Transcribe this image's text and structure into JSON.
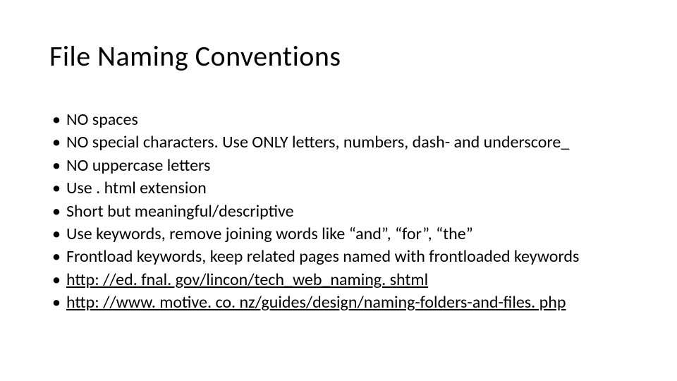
{
  "slide": {
    "title": "File Naming Conventions",
    "bullets": [
      {
        "text": "NO spaces",
        "link": false
      },
      {
        "text": "NO special characters. Use ONLY letters, numbers, dash- and underscore_",
        "link": false
      },
      {
        "text": "NO uppercase letters",
        "link": false
      },
      {
        "text": "Use . html extension",
        "link": false
      },
      {
        "text": "Short but meaningful/descriptive",
        "link": false
      },
      {
        "text": "Use keywords, remove joining words like “and”, “for”, “the”",
        "link": false
      },
      {
        "text": "Frontload keywords, keep related pages named with frontloaded keywords",
        "link": false
      },
      {
        "text": "http: //ed. fnal. gov/lincon/tech_web_naming. shtml",
        "link": true
      },
      {
        "text": "http: //www. motive. co. nz/guides/design/naming-folders-and-files. php",
        "link": true
      }
    ]
  }
}
